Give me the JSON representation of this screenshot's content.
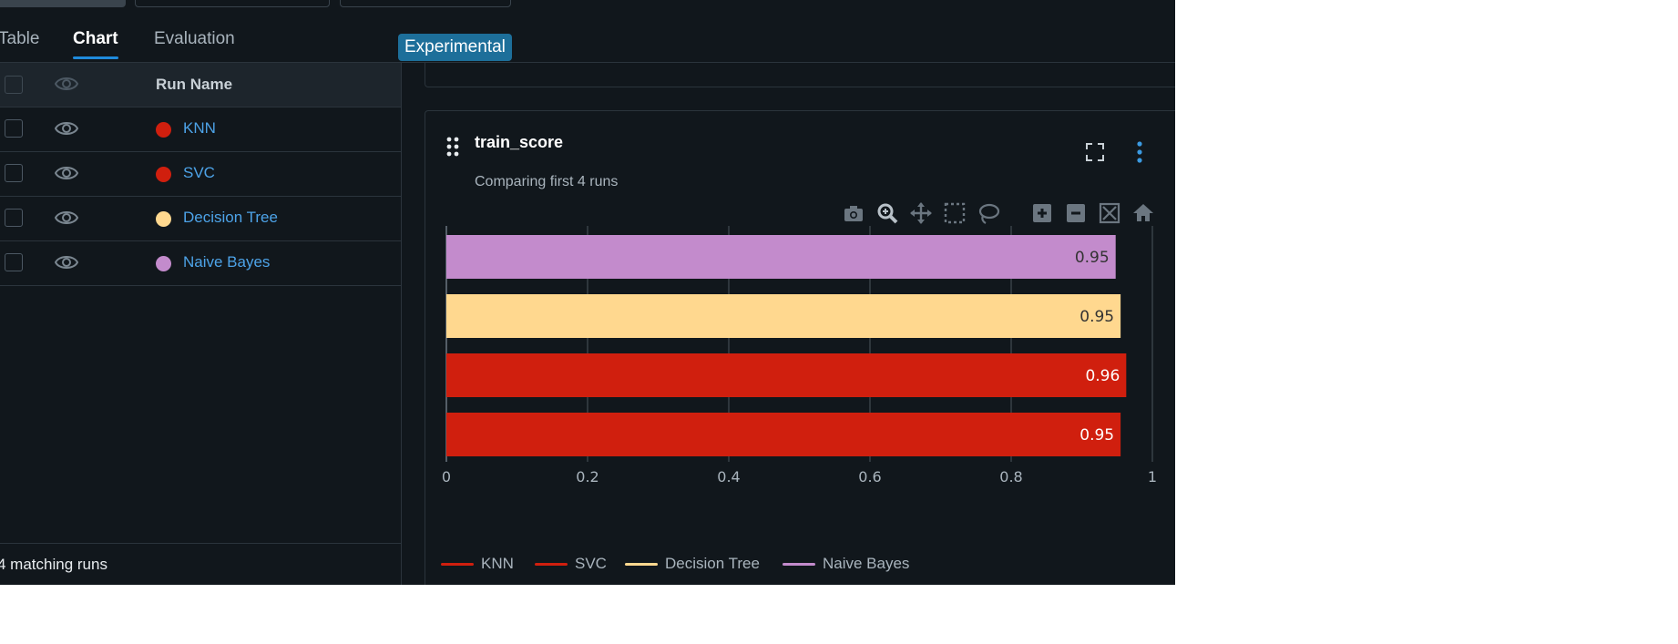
{
  "tabs": {
    "table": "Table",
    "chart": "Chart",
    "evaluation": "Evaluation",
    "experimental_badge": "Experimental"
  },
  "table": {
    "header_run_name": "Run Name",
    "rows": [
      {
        "name": "KNN",
        "color": "#d01f0e"
      },
      {
        "name": "SVC",
        "color": "#d01f0e"
      },
      {
        "name": "Decision Tree",
        "color": "#ffd88f"
      },
      {
        "name": "Naive Bayes",
        "color": "#c38bcc"
      }
    ],
    "footer": "4 matching runs"
  },
  "chart_card": {
    "title": "train_score",
    "subtitle": "Comparing first 4 runs"
  },
  "modebar": [
    "camera-icon",
    "zoom-icon",
    "pan-icon",
    "box-select-icon",
    "lasso-icon",
    "zoom-in-icon",
    "zoom-out-icon",
    "autoscale-icon",
    "reset-axes-icon"
  ],
  "chart_data": {
    "type": "bar",
    "orientation": "horizontal",
    "xlim": [
      0,
      1
    ],
    "xticks": [
      "0",
      "0.2",
      "0.4",
      "0.6",
      "0.8",
      "1"
    ],
    "grid": true,
    "legend_position": "bottom",
    "bars_top_to_bottom": [
      {
        "name": "Naive Bayes",
        "value": 0.948,
        "label": "0.95",
        "color": "#c38bcc",
        "label_color": "#333333"
      },
      {
        "name": "Decision Tree",
        "value": 0.955,
        "label": "0.95",
        "color": "#ffd88f",
        "label_color": "#333333"
      },
      {
        "name": "SVC",
        "value": 0.963,
        "label": "0.96",
        "color": "#d01f0e",
        "label_color": "#ffffff"
      },
      {
        "name": "KNN",
        "value": 0.955,
        "label": "0.95",
        "color": "#d01f0e",
        "label_color": "#ffffff"
      }
    ],
    "legend": [
      {
        "name": "KNN",
        "color": "#d01f0e"
      },
      {
        "name": "SVC",
        "color": "#d01f0e"
      },
      {
        "name": "Decision Tree",
        "color": "#ffd88f"
      },
      {
        "name": "Naive Bayes",
        "color": "#c38bcc"
      }
    ]
  }
}
